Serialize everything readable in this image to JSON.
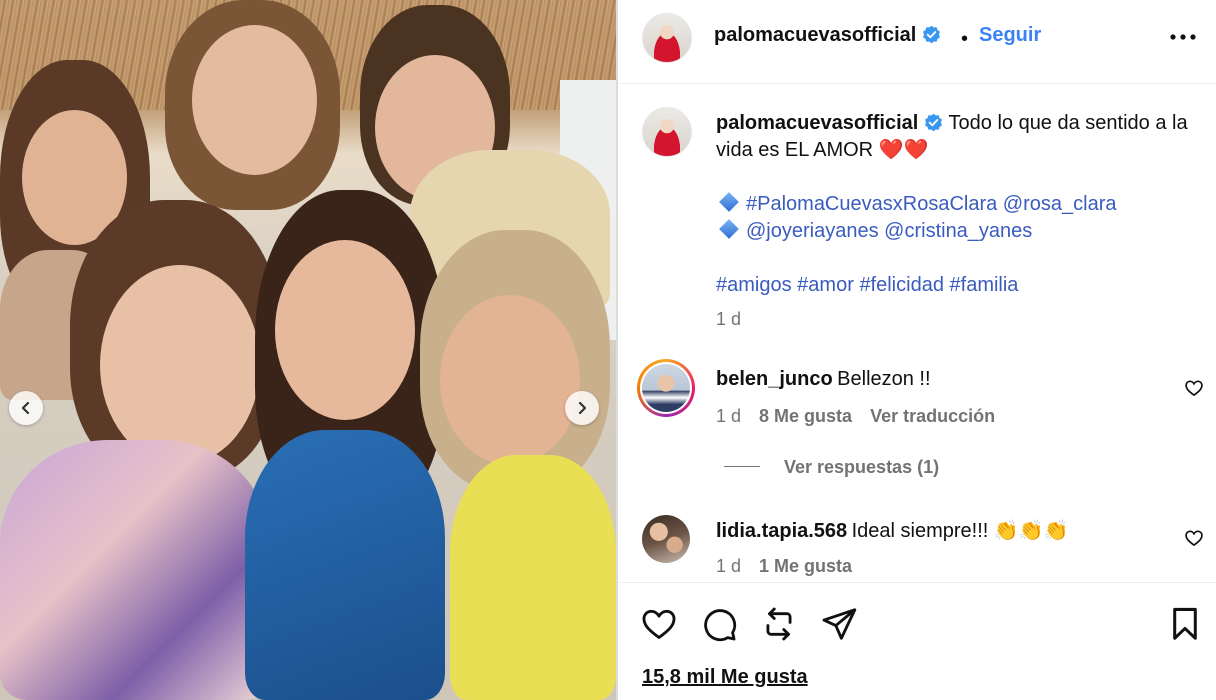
{
  "post": {
    "photo_alt": "photo",
    "carousel": {
      "prev": "previous",
      "next": "next"
    }
  },
  "header": {
    "username": "palomacuevasofficial",
    "separator": "•",
    "follow_label": "Seguir"
  },
  "caption": {
    "username": "palomacuevasofficial",
    "line1": "Todo lo que da sentido a la vida es EL AMOR ❤️❤️",
    "line2_tags": [
      "#PalomaCuevasxRosaClara",
      "@rosa_clara"
    ],
    "line3_tags": [
      "@joyeriayanes",
      "@cristina_yanes"
    ],
    "hashtags": [
      "#amigos",
      "#amor",
      "#felicidad",
      "#familia"
    ],
    "time": "1 d"
  },
  "comments": [
    {
      "username": "belen_junco",
      "text": "Bellezon !!",
      "time": "1 d",
      "likes": "8 Me gusta",
      "translate": "Ver traducción",
      "replies": "Ver respuestas (1)"
    },
    {
      "username": "lidia.tapia.568",
      "text": "Ideal siempre!!! 👏👏👏",
      "time": "1 d",
      "likes": "1 Me gusta"
    }
  ],
  "footer": {
    "likes_count": "15,8 mil Me gusta"
  },
  "colors": {
    "accent": "#3b82f6",
    "hashtag": "#3a5bbf",
    "muted": "#737373"
  }
}
